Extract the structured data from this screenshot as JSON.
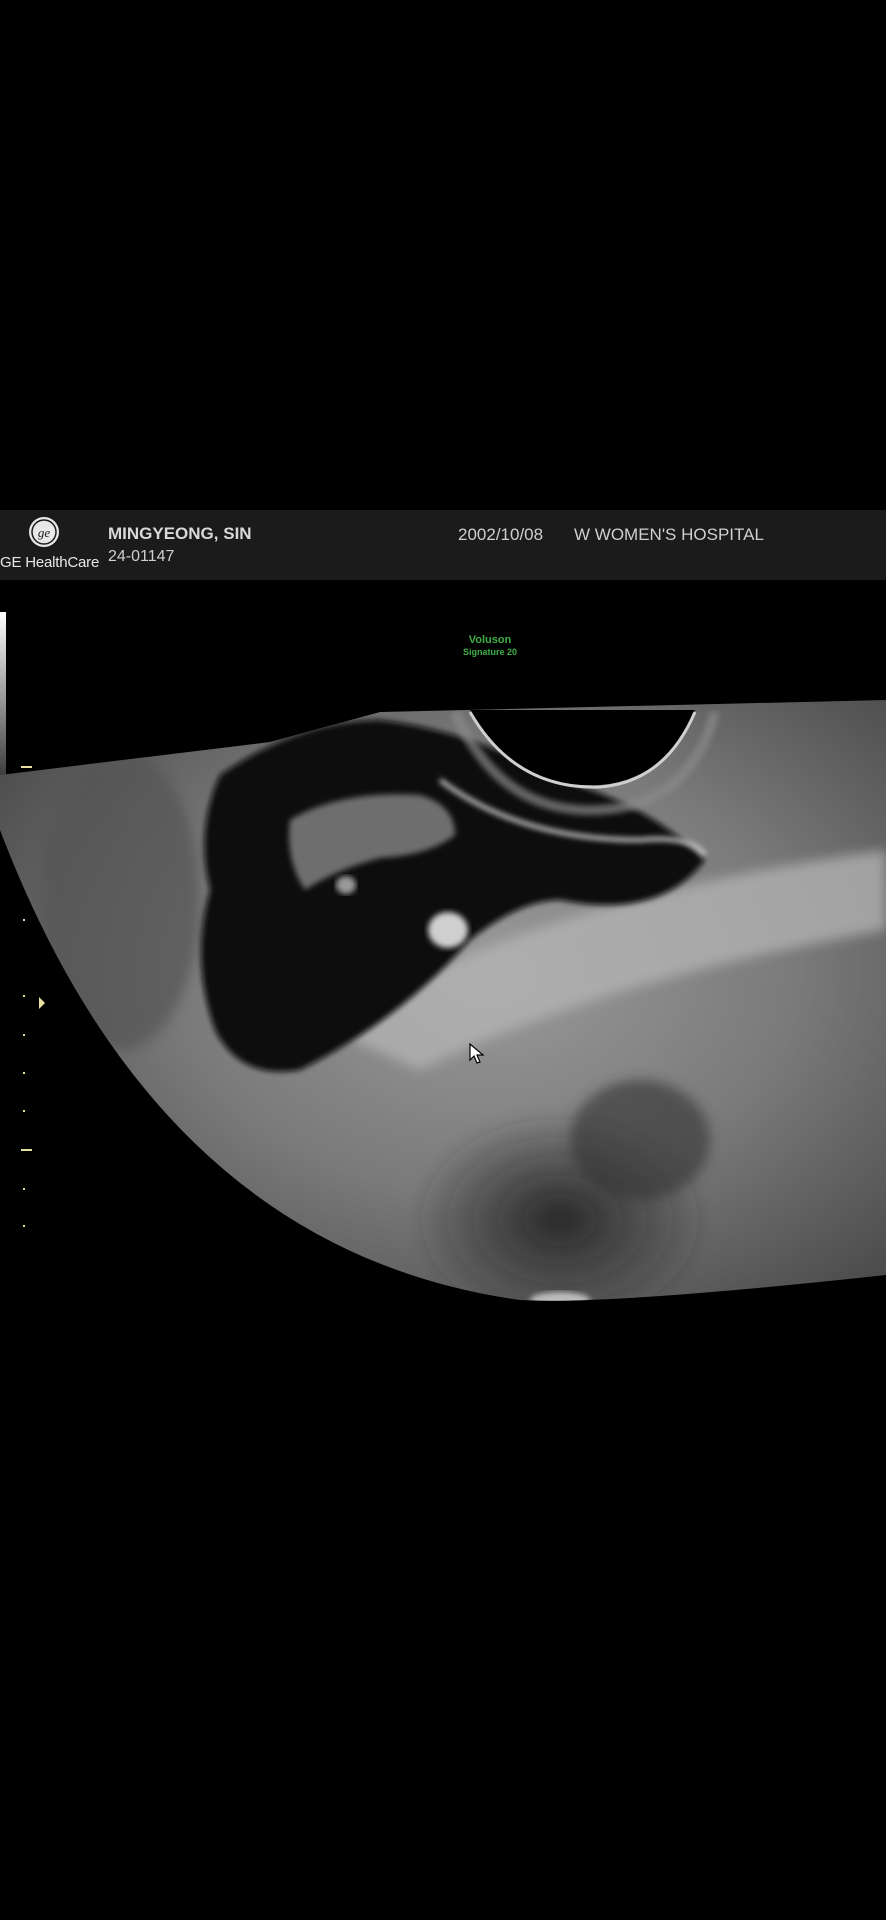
{
  "header": {
    "logo_text": "GE HealthCare",
    "logo_icon": "ge-monogram-icon",
    "patient_name": "MINGYEONG, SIN",
    "patient_id": "24-01147",
    "exam_date": "2002/10/08",
    "hospital": "W WOMEN'S HOSPITAL"
  },
  "scanner": {
    "brand": "Voluson",
    "model": "Signature 20"
  },
  "colors": {
    "background": "#000000",
    "header_bar": "#1b1b1b",
    "scanner_label": "#3fae45",
    "scale_marks": "#e8e0a0"
  }
}
